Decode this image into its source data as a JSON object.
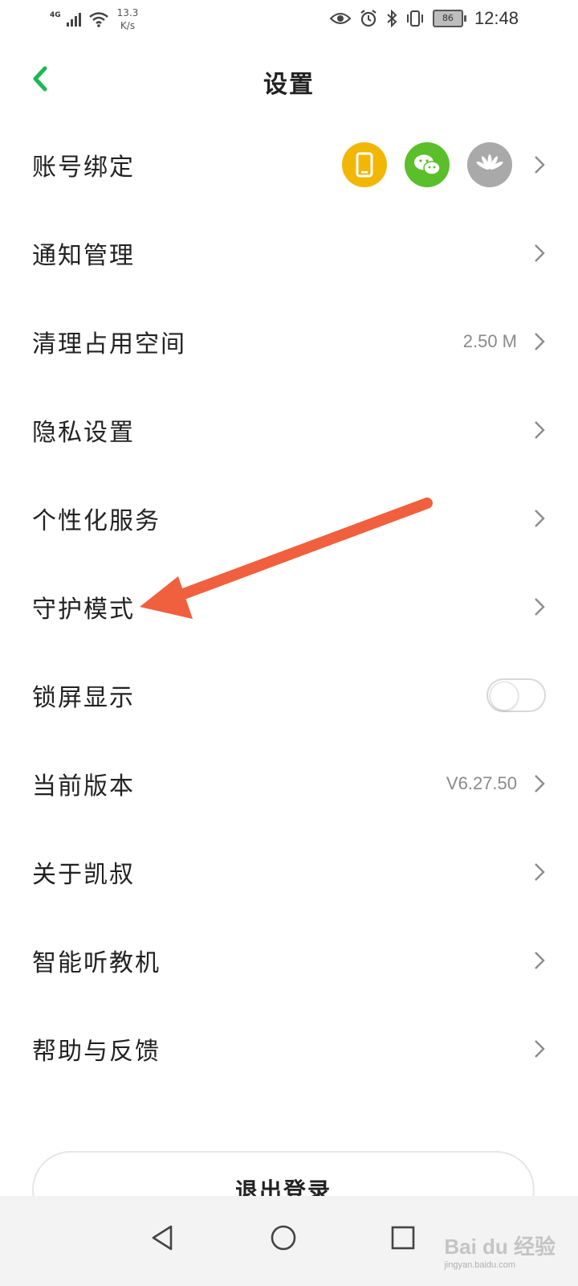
{
  "status_bar": {
    "network": "4G",
    "speed": "13.3",
    "speed_unit": "K/s",
    "battery": "86",
    "time": "12:48"
  },
  "header": {
    "title": "设置"
  },
  "settings": [
    {
      "label": "账号绑定",
      "value": ""
    },
    {
      "label": "通知管理",
      "value": ""
    },
    {
      "label": "清理占用空间",
      "value": "2.50 M"
    },
    {
      "label": "隐私设置",
      "value": ""
    },
    {
      "label": "个性化服务",
      "value": ""
    },
    {
      "label": "守护模式",
      "value": ""
    },
    {
      "label": "锁屏显示",
      "value": ""
    },
    {
      "label": "当前版本",
      "value": "V6.27.50"
    },
    {
      "label": "关于凯叔",
      "value": ""
    },
    {
      "label": "智能听教机",
      "value": ""
    },
    {
      "label": "帮助与反馈",
      "value": ""
    }
  ],
  "account_icons": [
    {
      "name": "phone-icon",
      "color": "#F2B705"
    },
    {
      "name": "wechat-icon",
      "color": "#5ABF2A"
    },
    {
      "name": "huawei-icon",
      "color": "#A9A9A9"
    }
  ],
  "lock_screen_toggle": {
    "on": false
  },
  "logout_label": "退出登录",
  "colors": {
    "accent": "#1DB954",
    "annotation_arrow": "#F0603F"
  },
  "watermark": {
    "logo": "Bai du 经验",
    "sub": "jingyan.baidu.com"
  }
}
